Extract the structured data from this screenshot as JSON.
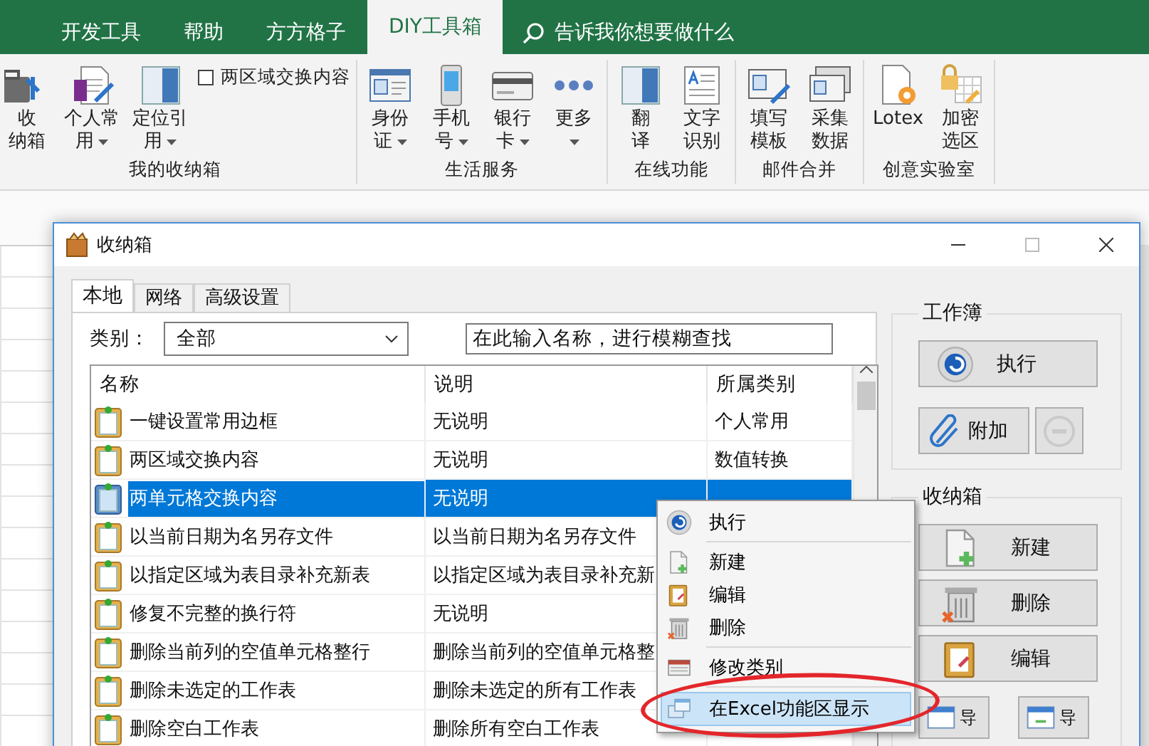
{
  "ribbon_tabs": [
    {
      "label": "开发工具",
      "selected": false
    },
    {
      "label": "帮助",
      "selected": false
    },
    {
      "label": "方方格子",
      "selected": false
    },
    {
      "label": "DIY工具箱",
      "selected": true
    }
  ],
  "tell_me": {
    "placeholder": "告诉我你想要做什么"
  },
  "ribbon_groups": [
    {
      "label": "我的收纳箱",
      "items": [
        {
          "kind": "large",
          "lines": [
            "收",
            "纳箱"
          ],
          "dropdown": false
        },
        {
          "kind": "large",
          "lines": [
            "个人常",
            "用"
          ],
          "dropdown": true
        },
        {
          "kind": "large",
          "lines": [
            "定位引",
            "用"
          ],
          "dropdown": true
        },
        {
          "kind": "checkbox",
          "label": "两区域交换内容",
          "checked": false
        }
      ]
    },
    {
      "label": "生活服务",
      "items": [
        {
          "kind": "large",
          "lines": [
            "身份",
            "证"
          ],
          "dropdown": true
        },
        {
          "kind": "large",
          "lines": [
            "手机",
            "号"
          ],
          "dropdown": true
        },
        {
          "kind": "large",
          "lines": [
            "银行",
            "卡"
          ],
          "dropdown": true
        },
        {
          "kind": "large",
          "lines": [
            "更多"
          ],
          "dropdown": true
        }
      ]
    },
    {
      "label": "在线功能",
      "items": [
        {
          "kind": "large",
          "lines": [
            "翻",
            "译"
          ],
          "dropdown": false
        },
        {
          "kind": "large",
          "lines": [
            "文字",
            "识别"
          ],
          "dropdown": false
        }
      ]
    },
    {
      "label": "邮件合并",
      "items": [
        {
          "kind": "large",
          "lines": [
            "填写",
            "模板"
          ],
          "dropdown": false
        },
        {
          "kind": "large",
          "lines": [
            "采集",
            "数据"
          ],
          "dropdown": false
        }
      ]
    },
    {
      "label": "创意实验室",
      "items": [
        {
          "kind": "large",
          "lines": [
            "Lotex"
          ],
          "dropdown": false
        },
        {
          "kind": "large",
          "lines": [
            "加密",
            "选区"
          ],
          "dropdown": false
        }
      ]
    }
  ],
  "dialog": {
    "title": "收纳箱",
    "tabs": [
      {
        "label": "本地",
        "selected": true
      },
      {
        "label": "网络",
        "selected": false
      },
      {
        "label": "高级设置",
        "selected": false
      }
    ],
    "category": {
      "label": "类别：",
      "value": "全部"
    },
    "search": {
      "value": "在此输入名称，进行模糊查找"
    },
    "table": {
      "columns": [
        "名称",
        "说明",
        "所属类别"
      ],
      "rows": [
        {
          "cells": [
            "一键设置常用边框",
            "无说明",
            "个人常用"
          ],
          "selected": false
        },
        {
          "cells": [
            "两区域交换内容",
            "无说明",
            "数值转换"
          ],
          "selected": false
        },
        {
          "cells": [
            "两单元格交换内容",
            "无说明"
          ],
          "selected": true
        },
        {
          "cells": [
            "以当前日期为名另存文件",
            "以当前日期为名另存文件"
          ],
          "selected": false
        },
        {
          "cells": [
            "以指定区域为表目录补充新表",
            "以指定区域为表目录补充新"
          ],
          "selected": false
        },
        {
          "cells": [
            "修复不完整的换行符",
            "无说明"
          ],
          "selected": false
        },
        {
          "cells": [
            "删除当前列的空值单元格整行",
            "删除当前列的空值单元格整"
          ],
          "selected": false
        },
        {
          "cells": [
            "删除未选定的工作表",
            "删除未选定的所有工作表"
          ],
          "selected": false
        },
        {
          "cells": [
            "删除空白工作表",
            "删除所有空白工作表"
          ],
          "selected": false
        }
      ]
    },
    "workbook": {
      "title": "工作簿",
      "buttons": [
        {
          "label": "执行",
          "disabled": false
        },
        {
          "label": "附加",
          "disabled": false
        },
        {
          "disabled": true
        }
      ]
    },
    "library": {
      "title": "收纳箱",
      "buttons": [
        {
          "label": "新建"
        },
        {
          "label": "删除"
        },
        {
          "label": "编辑"
        },
        {
          "label": "导"
        },
        {
          "label": "导"
        }
      ]
    }
  },
  "context_menu": {
    "items": [
      {
        "kind": "item",
        "label": "执行",
        "selected": false
      },
      {
        "kind": "separator"
      },
      {
        "kind": "item",
        "label": "新建",
        "selected": false
      },
      {
        "kind": "item",
        "label": "编辑",
        "selected": false
      },
      {
        "kind": "item",
        "label": "删除",
        "selected": false
      },
      {
        "kind": "separator"
      },
      {
        "kind": "item",
        "label": "修改类别",
        "selected": false
      },
      {
        "kind": "separator"
      },
      {
        "kind": "item",
        "label": "在Excel功能区显示",
        "selected": true
      }
    ]
  }
}
